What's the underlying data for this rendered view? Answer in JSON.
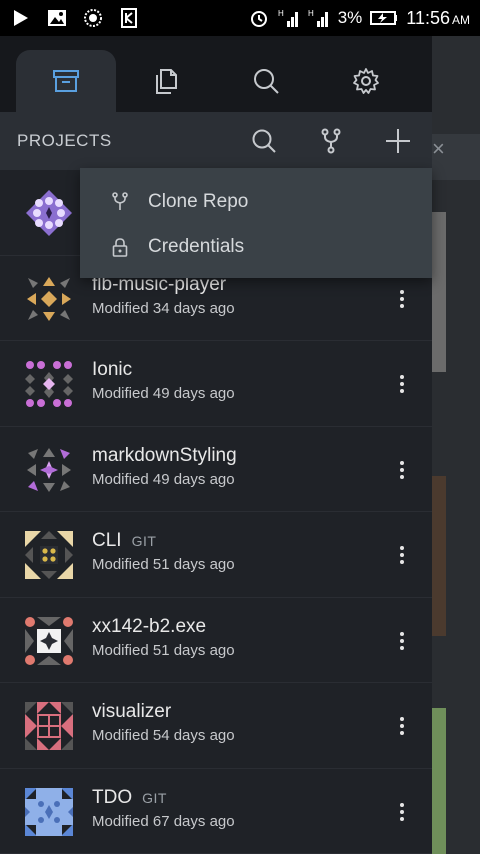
{
  "status_bar": {
    "battery_percent": "3%",
    "time": "11:56",
    "ampm": "AM",
    "icons": [
      "play-store-icon",
      "gallery-icon",
      "sync-icon",
      "app-icon",
      "alarm-icon",
      "signal-h-icon",
      "signal-h-icon",
      "battery-charging-icon"
    ]
  },
  "tabs": [
    {
      "name": "projects",
      "icon": "archive-icon",
      "active": true
    },
    {
      "name": "files",
      "icon": "files-icon",
      "active": false
    },
    {
      "name": "search",
      "icon": "search-icon",
      "active": false
    },
    {
      "name": "settings",
      "icon": "gear-icon",
      "active": false
    }
  ],
  "header": {
    "title": "PROJECTS"
  },
  "menu": {
    "items": [
      {
        "label": "Clone Repo",
        "icon": "fork-icon"
      },
      {
        "label": "Credentials",
        "icon": "lock-icon"
      }
    ]
  },
  "projects": [
    {
      "name": "",
      "modified": "",
      "git": "",
      "color": "#a67ce0"
    },
    {
      "name": "flb-music-player",
      "modified": "Modified 34 days ago",
      "git": "",
      "color": "#d9a85a"
    },
    {
      "name": "Ionic",
      "modified": "Modified 49 days ago",
      "git": "",
      "color": "#c96fd6"
    },
    {
      "name": "markdownStyling",
      "modified": "Modified 49 days ago",
      "git": "",
      "color": "#b26cd8"
    },
    {
      "name": "CLI",
      "modified": "Modified 51 days ago",
      "git": "GIT",
      "color": "#e9d7a8"
    },
    {
      "name": "xx142-b2.exe",
      "modified": "Modified 51 days ago",
      "git": "",
      "color": "#e07a6f"
    },
    {
      "name": "visualizer",
      "modified": "Modified 54 days ago",
      "git": "",
      "color": "#d86f7e"
    },
    {
      "name": "TDO",
      "modified": "Modified 67 days ago",
      "git": "GIT",
      "color": "#5b87d6"
    }
  ],
  "colors": {
    "drawer_bg": "#1f2227",
    "header_bg": "#2b2f35",
    "menu_bg": "#3a4147",
    "accent": "#5aa0e0"
  }
}
